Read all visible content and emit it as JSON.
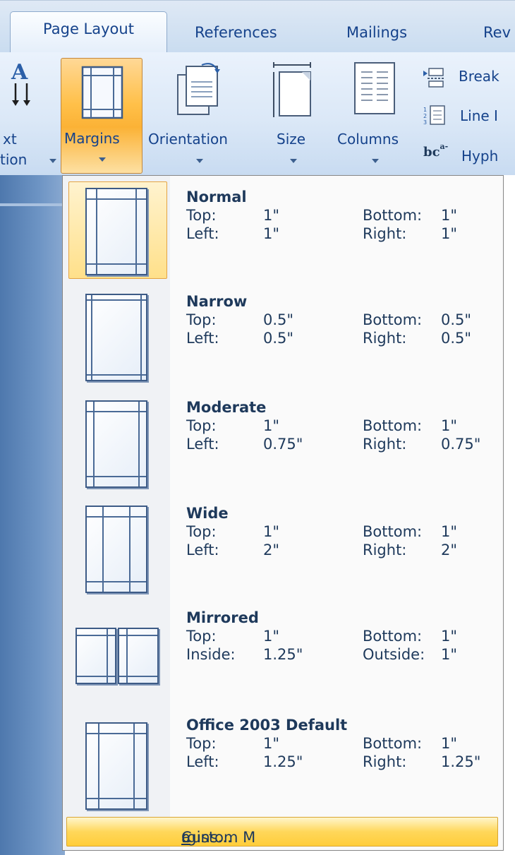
{
  "tabs": {
    "active": "Page Layout",
    "references": "References",
    "mailings": "Mailings",
    "review_partial": "Rev"
  },
  "ribbon": {
    "text_direction_line1": "xt",
    "text_direction_line2": "tion",
    "margins": "Margins",
    "orientation": "Orientation",
    "size": "Size",
    "columns": "Columns",
    "breaks_partial": "Break",
    "line_numbers_partial": "Line I",
    "hyphenation_partial": "Hyph",
    "hyphenation_icon_text": "bc"
  },
  "menu": {
    "items": [
      {
        "name": "Normal",
        "l1a": "Top:",
        "v1a": "1\"",
        "l1b": "Bottom:",
        "v1b": "1\"",
        "l2a": "Left:",
        "v2a": "1\"",
        "l2b": "Right:",
        "v2b": "1\""
      },
      {
        "name": "Narrow",
        "l1a": "Top:",
        "v1a": "0.5\"",
        "l1b": "Bottom:",
        "v1b": "0.5\"",
        "l2a": "Left:",
        "v2a": "0.5\"",
        "l2b": "Right:",
        "v2b": "0.5\""
      },
      {
        "name": "Moderate",
        "l1a": "Top:",
        "v1a": "1\"",
        "l1b": "Bottom:",
        "v1b": "1\"",
        "l2a": "Left:",
        "v2a": "0.75\"",
        "l2b": "Right:",
        "v2b": "0.75\""
      },
      {
        "name": "Wide",
        "l1a": "Top:",
        "v1a": "1\"",
        "l1b": "Bottom:",
        "v1b": "1\"",
        "l2a": "Left:",
        "v2a": "2\"",
        "l2b": "Right:",
        "v2b": "2\""
      },
      {
        "name": "Mirrored",
        "l1a": "Top:",
        "v1a": "1\"",
        "l1b": "Bottom:",
        "v1b": "1\"",
        "l2a": "Inside:",
        "v2a": "1.25\"",
        "l2b": "Outside:",
        "v2b": "1\""
      },
      {
        "name": "Office 2003 Default",
        "l1a": "Top:",
        "v1a": "1\"",
        "l1b": "Bottom:",
        "v1b": "1\"",
        "l2a": "Left:",
        "v2a": "1.25\"",
        "l2b": "Right:",
        "v2b": "1.25\""
      }
    ],
    "custom_pre": "Custom M",
    "custom_accel": "a",
    "custom_post": "rgins..."
  },
  "colors": {
    "accent_highlight": "#ffc049",
    "ribbon_text": "#15428b",
    "menu_text": "#1e395b"
  }
}
